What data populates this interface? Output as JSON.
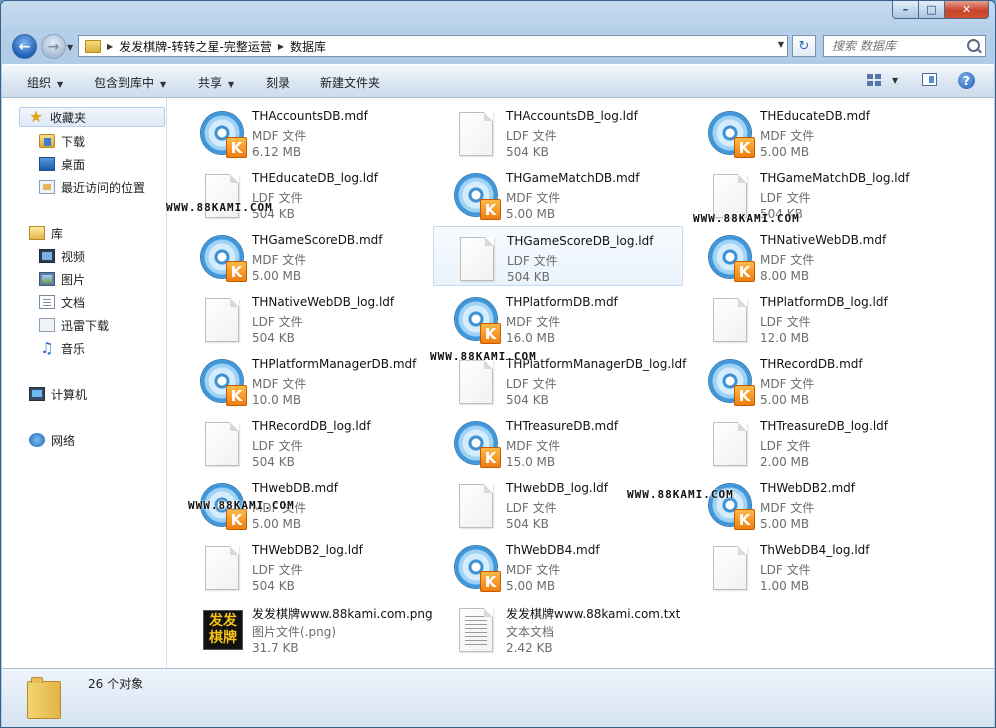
{
  "address": {
    "segments": [
      "发发棋牌-转转之星-完整运营",
      "数据库"
    ]
  },
  "search": {
    "placeholder": "搜索 数据库"
  },
  "toolbar": {
    "organize": "组织",
    "include_in_library": "包含到库中",
    "share": "共享",
    "burn": "刻录",
    "new_folder": "新建文件夹"
  },
  "sidebar": {
    "favorites": "收藏夹",
    "downloads": "下载",
    "desktop": "桌面",
    "recent": "最近访问的位置",
    "libraries": "库",
    "videos": "视频",
    "pictures": "图片",
    "documents": "文档",
    "xunlei": "迅雷下载",
    "music": "音乐",
    "computer": "计算机",
    "network": "网络"
  },
  "files": [
    {
      "name": "THAccountsDB.mdf",
      "type": "MDF 文件",
      "size": "6.12 MB",
      "icon": "mdf"
    },
    {
      "name": "THAccountsDB_log.ldf",
      "type": "LDF 文件",
      "size": "504 KB",
      "icon": "ldf"
    },
    {
      "name": "THEducateDB.mdf",
      "type": "MDF 文件",
      "size": "5.00 MB",
      "icon": "mdf"
    },
    {
      "name": "THEducateDB_log.ldf",
      "type": "LDF 文件",
      "size": "504 KB",
      "icon": "ldf"
    },
    {
      "name": "THGameMatchDB.mdf",
      "type": "MDF 文件",
      "size": "5.00 MB",
      "icon": "mdf"
    },
    {
      "name": "THGameMatchDB_log.ldf",
      "type": "LDF 文件",
      "size": "504 KB",
      "icon": "ldf"
    },
    {
      "name": "THGameScoreDB.mdf",
      "type": "MDF 文件",
      "size": "5.00 MB",
      "icon": "mdf"
    },
    {
      "name": "THGameScoreDB_log.ldf",
      "type": "LDF 文件",
      "size": "504 KB",
      "icon": "ldf",
      "selected": true
    },
    {
      "name": "THNativeWebDB.mdf",
      "type": "MDF 文件",
      "size": "8.00 MB",
      "icon": "mdf"
    },
    {
      "name": "THNativeWebDB_log.ldf",
      "type": "LDF 文件",
      "size": "504 KB",
      "icon": "ldf"
    },
    {
      "name": "THPlatformDB.mdf",
      "type": "MDF 文件",
      "size": "16.0 MB",
      "icon": "mdf"
    },
    {
      "name": "THPlatformDB_log.ldf",
      "type": "LDF 文件",
      "size": "12.0 MB",
      "icon": "ldf"
    },
    {
      "name": "THPlatformManagerDB.mdf",
      "type": "MDF 文件",
      "size": "10.0 MB",
      "icon": "mdf"
    },
    {
      "name": "THPlatformManagerDB_log.ldf",
      "type": "LDF 文件",
      "size": "504 KB",
      "icon": "ldf"
    },
    {
      "name": "THRecordDB.mdf",
      "type": "MDF 文件",
      "size": "5.00 MB",
      "icon": "mdf"
    },
    {
      "name": "THRecordDB_log.ldf",
      "type": "LDF 文件",
      "size": "504 KB",
      "icon": "ldf"
    },
    {
      "name": "THTreasureDB.mdf",
      "type": "MDF 文件",
      "size": "15.0 MB",
      "icon": "mdf"
    },
    {
      "name": "THTreasureDB_log.ldf",
      "type": "LDF 文件",
      "size": "2.00 MB",
      "icon": "ldf"
    },
    {
      "name": "THwebDB.mdf",
      "type": "MDF 文件",
      "size": "5.00 MB",
      "icon": "mdf"
    },
    {
      "name": "THwebDB_log.ldf",
      "type": "LDF 文件",
      "size": "504 KB",
      "icon": "ldf"
    },
    {
      "name": "THWebDB2.mdf",
      "type": "MDF 文件",
      "size": "5.00 MB",
      "icon": "mdf"
    },
    {
      "name": "THWebDB2_log.ldf",
      "type": "LDF 文件",
      "size": "504 KB",
      "icon": "ldf"
    },
    {
      "name": "ThWebDB4.mdf",
      "type": "MDF 文件",
      "size": "5.00 MB",
      "icon": "mdf"
    },
    {
      "name": "ThWebDB4_log.ldf",
      "type": "LDF 文件",
      "size": "1.00 MB",
      "icon": "ldf"
    },
    {
      "name": "发发棋牌www.88kami.com.png",
      "type": "图片文件(.png)",
      "size": "31.7 KB",
      "icon": "png"
    },
    {
      "name": "发发棋牌www.88kami.com.txt",
      "type": "文本文档",
      "size": "2.42 KB",
      "icon": "txt"
    }
  ],
  "icon_labels": {
    "mdf_badge": "K",
    "png_logo_top": "发发",
    "png_logo_bottom": "棋牌"
  },
  "watermark": "WWW.88KAMI.COM",
  "status": {
    "count": "26 个对象"
  }
}
